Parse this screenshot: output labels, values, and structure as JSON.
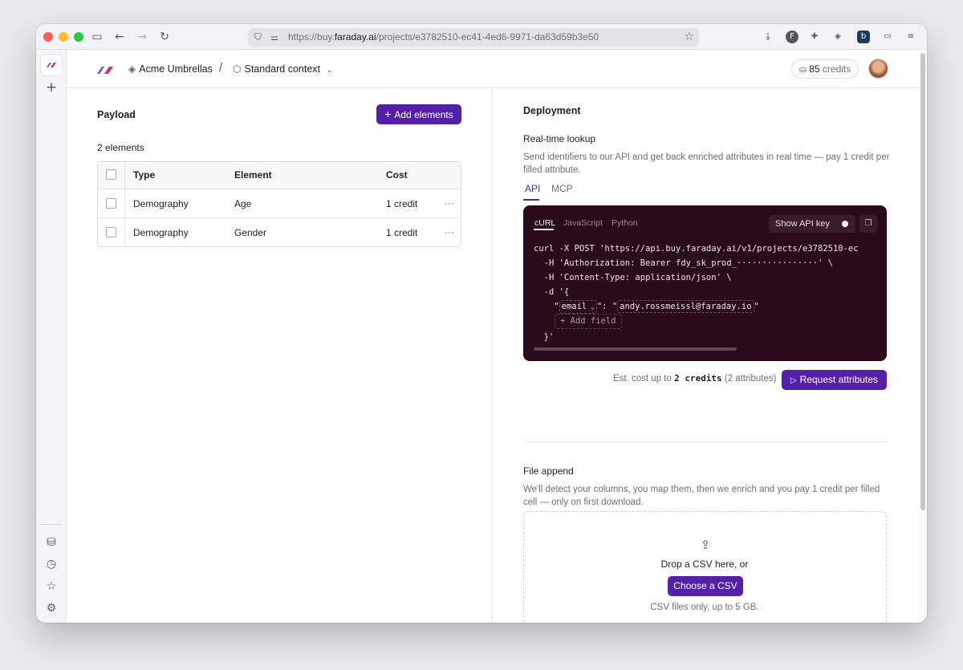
{
  "browser": {
    "url_prefix": "https://buy.",
    "url_domain": "faraday.ai",
    "url_path": "/projects/e3782510-ec41-4ed6-9971-da63d59b3e50"
  },
  "header": {
    "workspace": "Acme Umbrellas",
    "separator": "/",
    "context": "Standard context",
    "credits_count": "85",
    "credits_label": "credits"
  },
  "payload": {
    "title": "Payload",
    "add_button": "Add elements",
    "count_label": "2 elements",
    "columns": [
      "Type",
      "Element",
      "Cost"
    ],
    "rows": [
      {
        "type": "Demography",
        "element": "Age",
        "cost": "1 credit"
      },
      {
        "type": "Demography",
        "element": "Gender",
        "cost": "1 credit"
      }
    ],
    "row_menu": "···"
  },
  "deployment": {
    "title": "Deployment",
    "realtime_title": "Real-time lookup",
    "realtime_desc_1": "Send identifiers to our API and get back enriched attributes in real time — pay 1 credit per",
    "realtime_desc_2": "filled attribute.",
    "tabs": [
      "API",
      "MCP"
    ],
    "code_tabs": [
      "cURL",
      "JavaScript",
      "Python"
    ],
    "show_api_key": "Show API key",
    "code": {
      "line1": "curl -X POST 'https://api.buy.faraday.ai/v1/projects/e3782510-ec",
      "line2": "  -H 'Authorization: Bearer fdy_sk_prod_················' \\",
      "line3": "  -H 'Content-Type: application/json' \\",
      "line4": "  -d '{",
      "field_key": "email",
      "field_value": "andy.rossmeissl@faraday.io",
      "add_field": "+ Add field",
      "line_end": "  }'"
    },
    "est_prefix": "Est. cost up to",
    "est_value": "2 credits",
    "est_suffix": "(2 attributes)",
    "request_button": "Request attributes",
    "file_title": "File append",
    "file_desc_1": "We'll detect your columns, you map them, then we enrich and you pay 1 credit per filled",
    "file_desc_2": "cell — only on first download.",
    "drop_text": "Drop a CSV here, or",
    "choose_button": "Choose a CSV",
    "file_limit": "CSV files only, up to 5 GB."
  },
  "colors": {
    "accent": "#5420a8",
    "code_bg": "#2a0a1d"
  }
}
